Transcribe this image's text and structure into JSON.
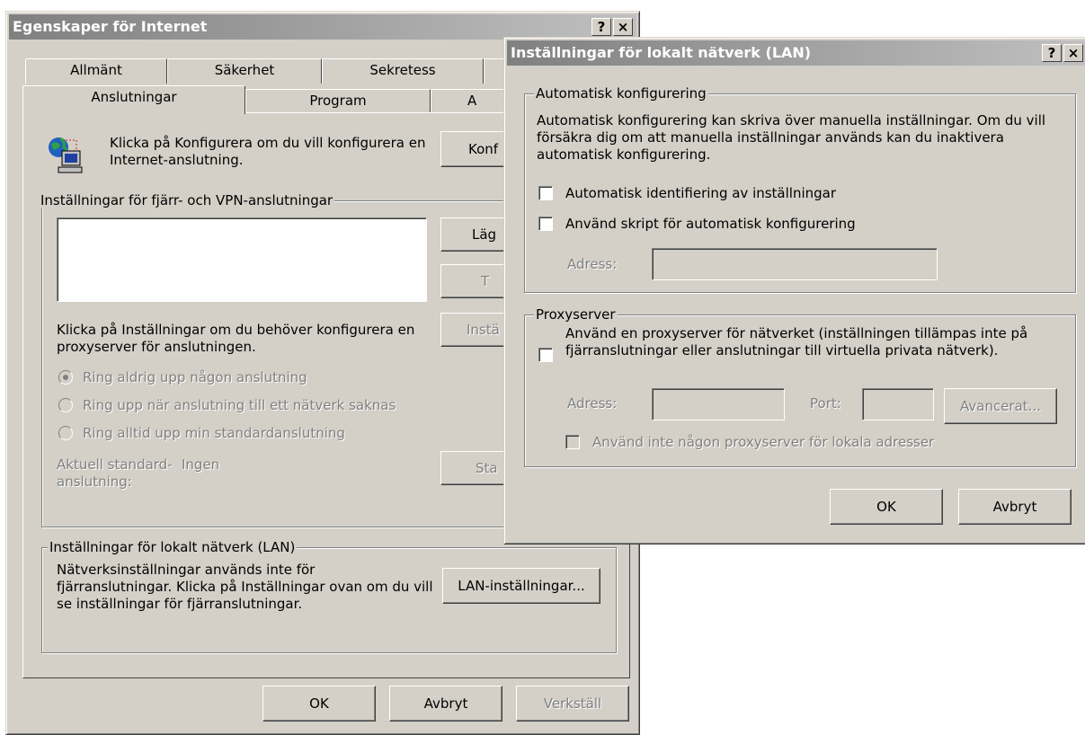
{
  "main_dialog": {
    "title": "Egenskaper för Internet",
    "help_btn": "?",
    "close_btn": "×",
    "tabs_row1": [
      "Allmänt",
      "Säkerhet",
      "Sekretess"
    ],
    "tabs_row2": [
      "Anslutningar",
      "Program",
      "A"
    ],
    "setup_text": "Klicka på Konfigurera om du vill konfigurera en Internet-anslutning.",
    "configure_btn": "Konf",
    "dialup_group": "Inställningar för fjärr- och VPN-anslutningar",
    "add_btn": "Läg",
    "remove_btn": "T",
    "settings_btn": "Instä",
    "proxy_text": "Klicka på Inställningar om du behöver konfigurera en proxyserver för anslutningen.",
    "radio_never": "Ring aldrig upp någon anslutning",
    "radio_when_missing": "Ring upp när anslutning till ett nätverk saknas",
    "radio_always": "Ring alltid upp min standardanslutning",
    "current_default_label": "Aktuell standard-\nanslutning:",
    "current_default_value": "Ingen",
    "set_default_btn": "Sta",
    "lan_group": "Inställningar för lokalt nätverk (LAN)",
    "lan_text": "Nätverksinställningar används inte för fjärranslutningar. Klicka på Inställningar ovan om du vill se inställningar för fjärranslutningar.",
    "lan_btn": "LAN-inställningar...",
    "ok": "OK",
    "cancel": "Avbryt",
    "apply": "Verkställ"
  },
  "lan_dialog": {
    "title": "Inställningar för lokalt nätverk (LAN)",
    "help_btn": "?",
    "close_btn": "×",
    "auto_group": "Automatisk konfigurering",
    "auto_text": "Automatisk konfigurering kan skriva över manuella inställningar. Om du vill försäkra dig om att manuella inställningar används kan du inaktivera automatisk konfigurering.",
    "auto_detect": "Automatisk identifiering av inställningar",
    "use_script": "Använd skript för automatisk konfigurering",
    "address_label": "Adress:",
    "address_value": "",
    "proxy_group": "Proxyserver",
    "use_proxy": "Använd en proxyserver för nätverket (inställningen tillämpas inte på fjärranslutningar eller anslutningar till virtuella privata nätverk).",
    "proxy_address_label": "Adress:",
    "proxy_address_value": "",
    "port_label": "Port:",
    "port_value": "",
    "advanced_btn": "Avancerat...",
    "bypass_local": "Använd inte någon proxyserver för lokala adresser",
    "ok": "OK",
    "cancel": "Avbryt"
  },
  "colors": {
    "face": "#d4d0c8",
    "title_inactive_start": "#808080",
    "title_inactive_end": "#c0c0c0"
  }
}
